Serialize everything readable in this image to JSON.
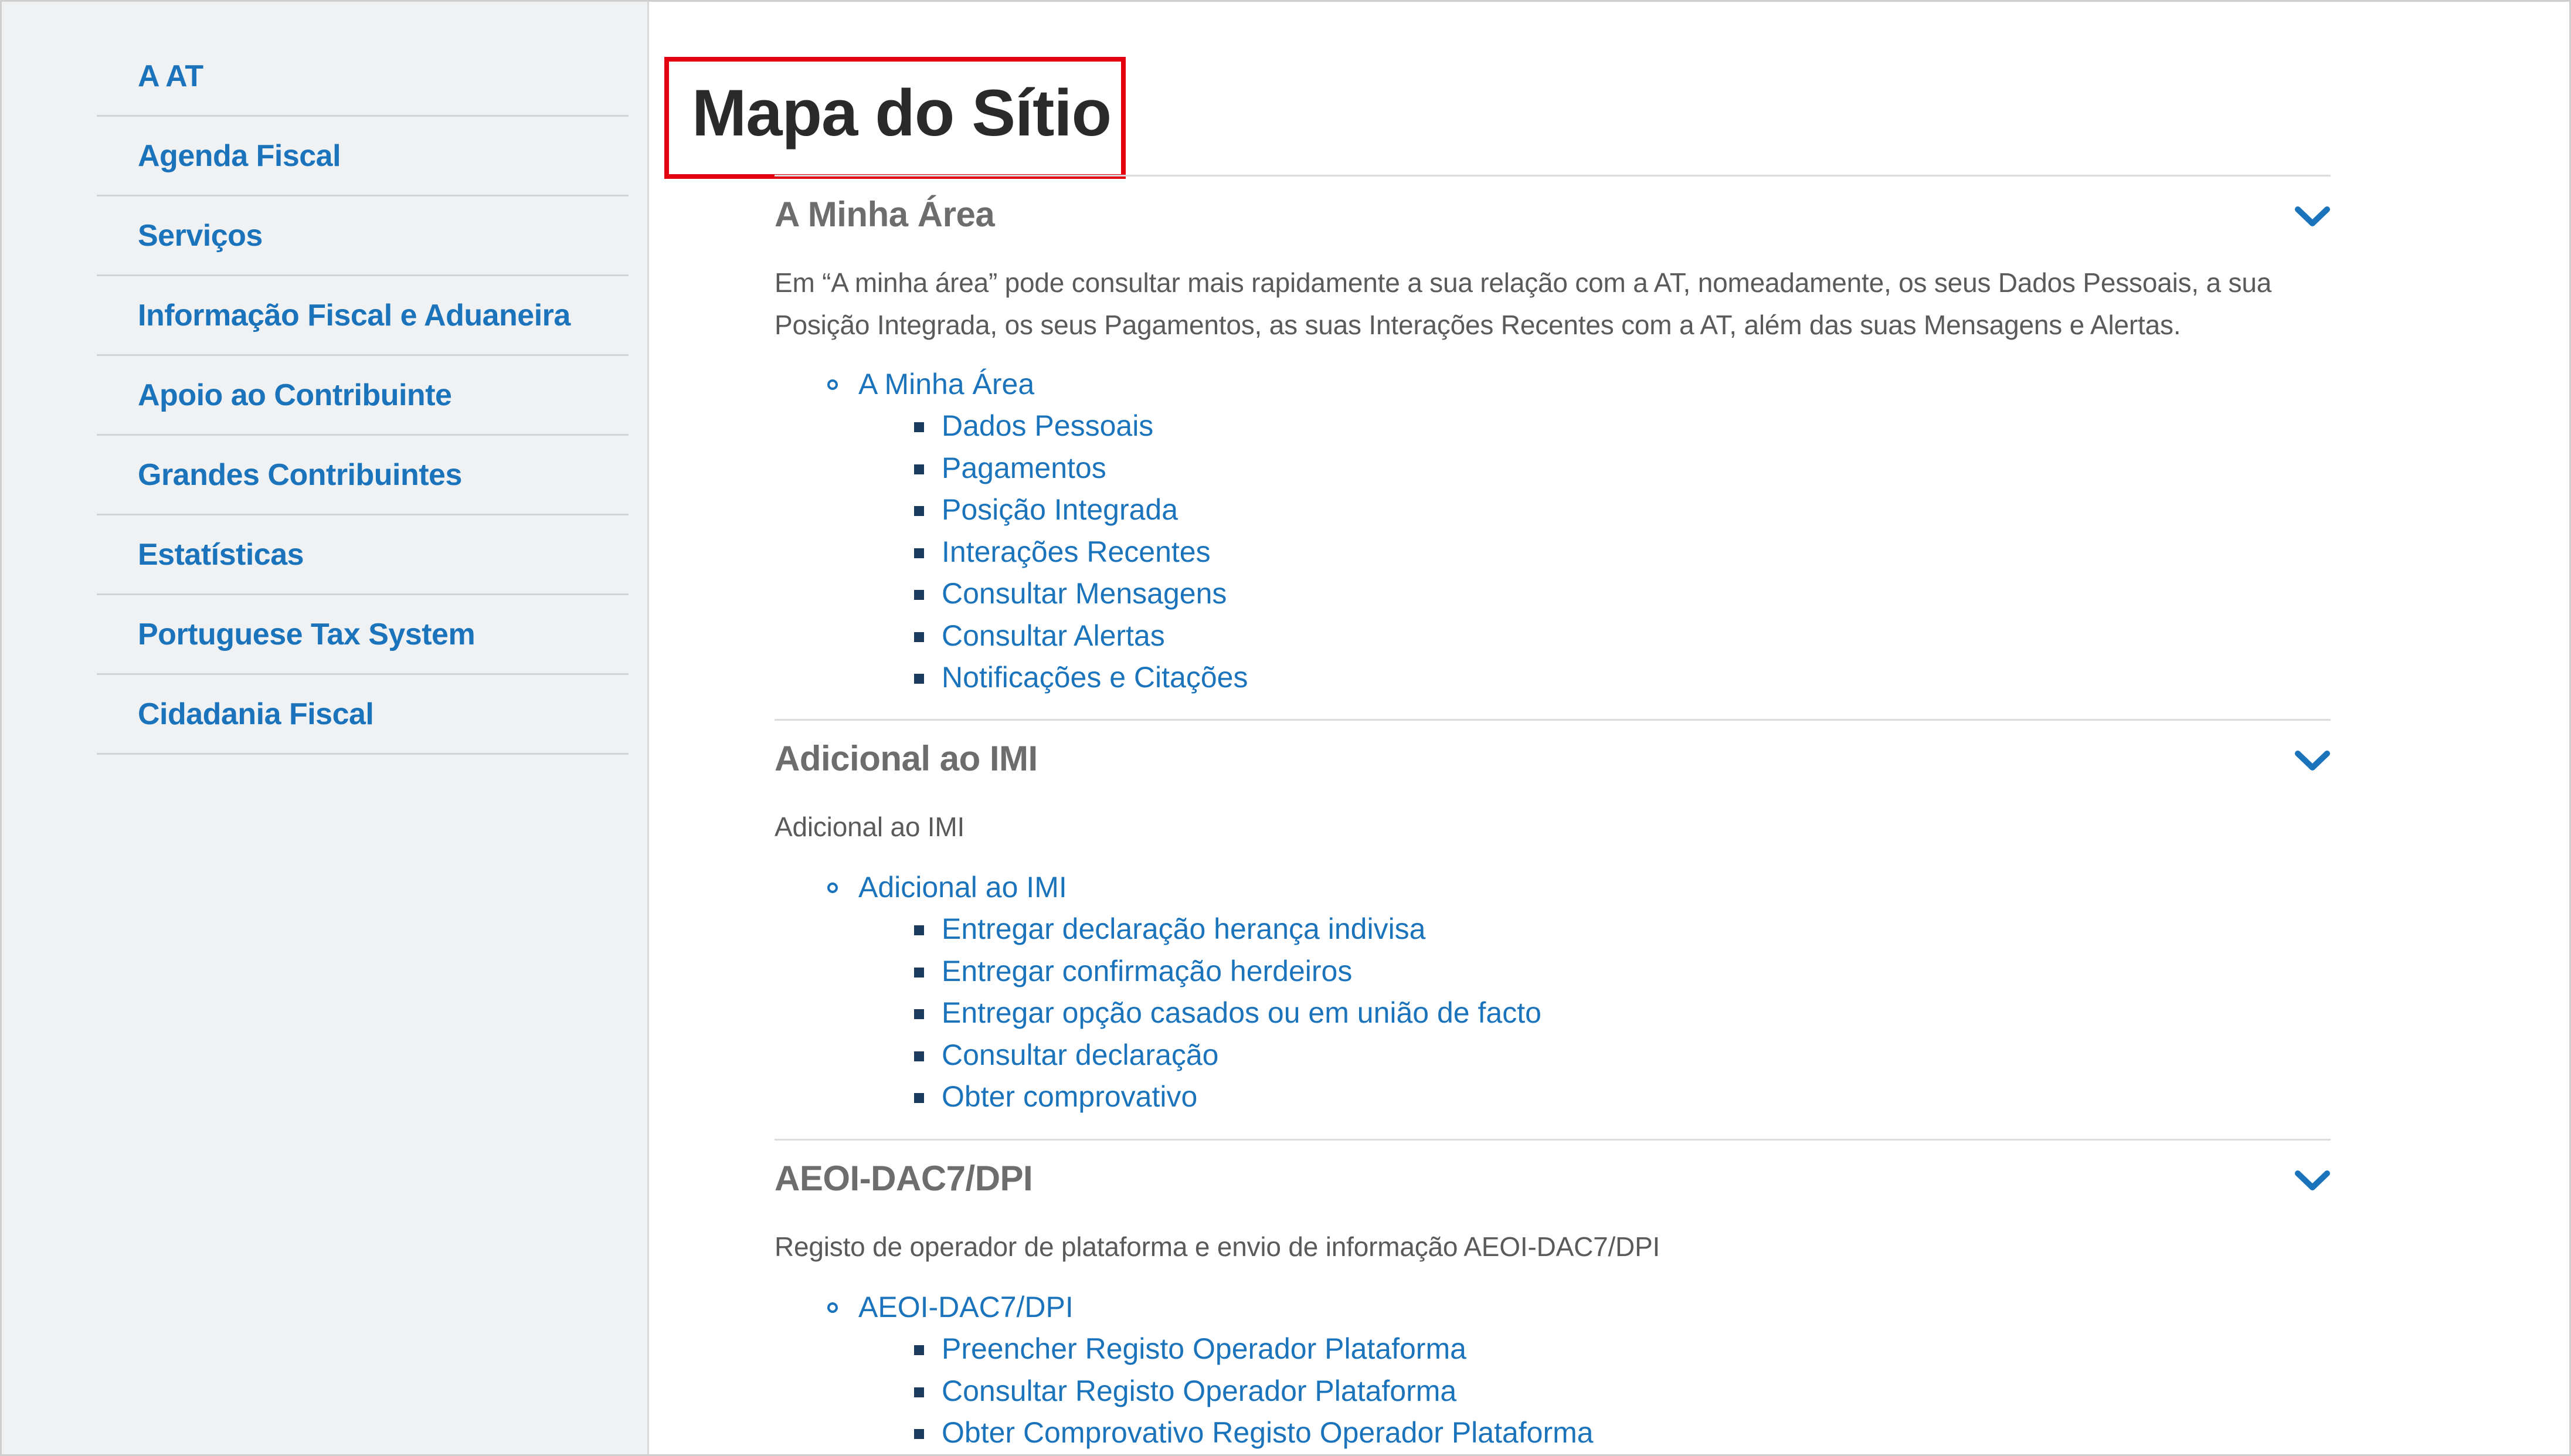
{
  "sidebar": {
    "items": [
      {
        "label": "A AT"
      },
      {
        "label": "Agenda Fiscal"
      },
      {
        "label": "Serviços"
      },
      {
        "label": "Informação Fiscal e Aduaneira"
      },
      {
        "label": "Apoio ao Contribuinte"
      },
      {
        "label": "Grandes Contribuintes"
      },
      {
        "label": "Estatísticas"
      },
      {
        "label": "Portuguese Tax System"
      },
      {
        "label": "Cidadania Fiscal"
      }
    ]
  },
  "page": {
    "title": "Mapa do Sítio"
  },
  "sections": [
    {
      "heading": "A Minha Área",
      "description": "Em “A minha área” pode consultar mais rapidamente a sua relação com a AT, nomeadamente, os seus Dados Pessoais, a sua Posição Integrada, os seus Pagamentos, as suas Interações Recentes com a AT, além das suas Mensagens e Alertas.",
      "group": "A Minha Área",
      "links": [
        "Dados Pessoais",
        "Pagamentos",
        "Posição Integrada",
        "Interações Recentes",
        "Consultar Mensagens",
        "Consultar Alertas",
        "Notificações e Citações"
      ]
    },
    {
      "heading": "Adicional ao IMI",
      "description": "Adicional ao IMI",
      "group": "Adicional ao IMI",
      "links": [
        "Entregar declaração herança indivisa",
        "Entregar confirmação herdeiros",
        "Entregar opção casados ou em união de facto",
        "Consultar declaração",
        "Obter comprovativo"
      ]
    },
    {
      "heading": "AEOI-DAC7/DPI",
      "description": "Registo de operador de plataforma e envio de informação AEOI-DAC7/DPI",
      "group": "AEOI-DAC7/DPI",
      "links": [
        "Preencher Registo Operador Plataforma",
        "Consultar Registo Operador Plataforma",
        "Obter Comprovativo Registo Operador Plataforma"
      ]
    }
  ],
  "colors": {
    "link": "#1b74bb",
    "highlight": "#e3000f",
    "sidebar_bg": "#eff1f3"
  }
}
